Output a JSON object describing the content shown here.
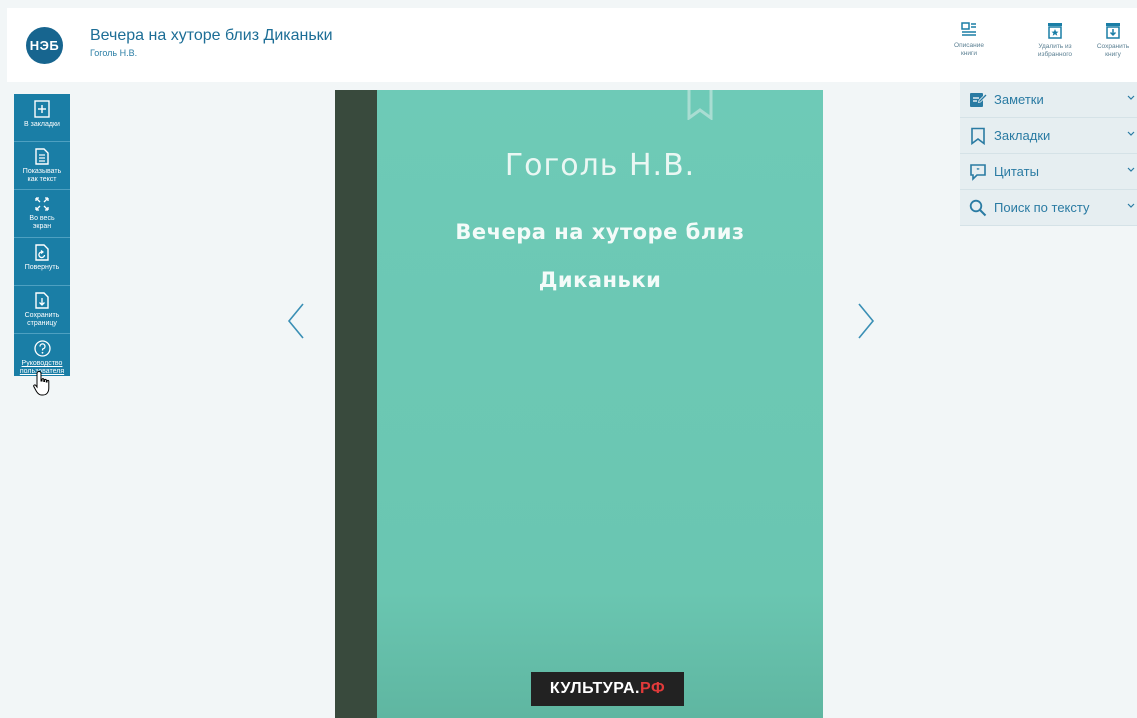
{
  "header": {
    "logo_text": "НЭБ",
    "book_title": "Вечера на хуторе близ Диканьки",
    "book_author": "Гоголь Н.В.",
    "tools": [
      {
        "label_1": "Описание",
        "label_2": "книги",
        "icon": "book-description-icon"
      },
      {
        "label_1": "Удалить из",
        "label_2": "избранного",
        "icon": "remove-favorite-icon"
      },
      {
        "label_1": "Сохранить",
        "label_2": "книгу",
        "icon": "save-book-icon"
      }
    ]
  },
  "left_toolbar": {
    "bookmark_label": "В закладки",
    "show_text_1": "Показывать",
    "show_text_2": "как текст",
    "fullscreen_1": "Во весь",
    "fullscreen_2": "экран",
    "rotate_label": "Повернуть",
    "save_page_1": "Сохранить",
    "save_page_2": "страницу",
    "guide_1": "Руководство",
    "guide_2": "пользователя"
  },
  "cover": {
    "author": "Гоголь Н.В.",
    "title_line_1": "Вечера на хуторе близ",
    "title_line_2": "Диканьки",
    "publisher_main": "КУЛЬТУРА.",
    "publisher_suffix": "РФ"
  },
  "right_panel": {
    "items": [
      {
        "label": "Заметки",
        "icon": "notes-icon"
      },
      {
        "label": "Закладки",
        "icon": "bookmarks-icon"
      },
      {
        "label": "Цитаты",
        "icon": "quotes-icon"
      },
      {
        "label": "Поиск по тексту",
        "icon": "search-icon"
      }
    ]
  },
  "colors": {
    "brand": "#1a7ea6",
    "cover": "#6ecab7",
    "spine": "#394a3d"
  }
}
